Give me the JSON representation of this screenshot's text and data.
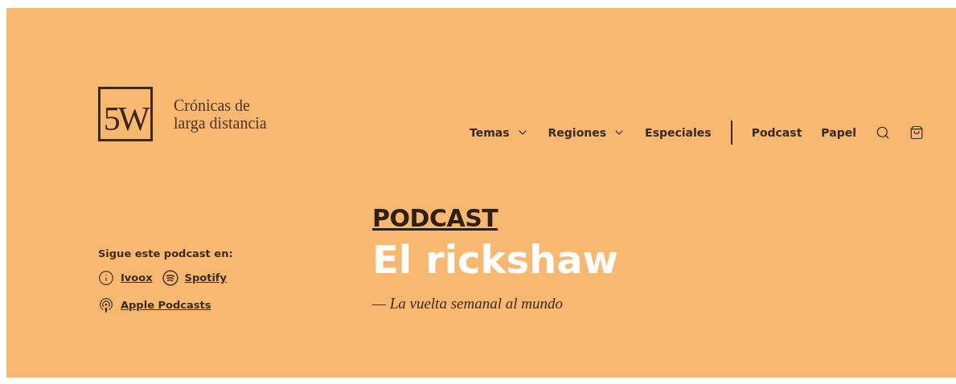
{
  "logo": {
    "mark": "5W",
    "tagline_lines": [
      "Crónicas de",
      "larga distancia"
    ]
  },
  "nav": {
    "items": [
      {
        "label": "Temas",
        "kind": "dropdown"
      },
      {
        "label": "Regiones",
        "kind": "dropdown"
      },
      {
        "label": "Especiales",
        "kind": "link"
      },
      {
        "label": "Podcast",
        "kind": "link"
      },
      {
        "label": "Papel",
        "kind": "link"
      }
    ]
  },
  "follow": {
    "heading": "Sigue este podcast en:",
    "links": [
      {
        "label": "Ivoox",
        "kind": "ivoox"
      },
      {
        "label": "Spotify",
        "kind": "spotify"
      },
      {
        "label": "Apple Podcasts",
        "kind": "apple"
      }
    ]
  },
  "hero": {
    "section": "PODCAST",
    "title": "El rickshaw",
    "subtitle": "— La vuelta semanal al mundo"
  }
}
